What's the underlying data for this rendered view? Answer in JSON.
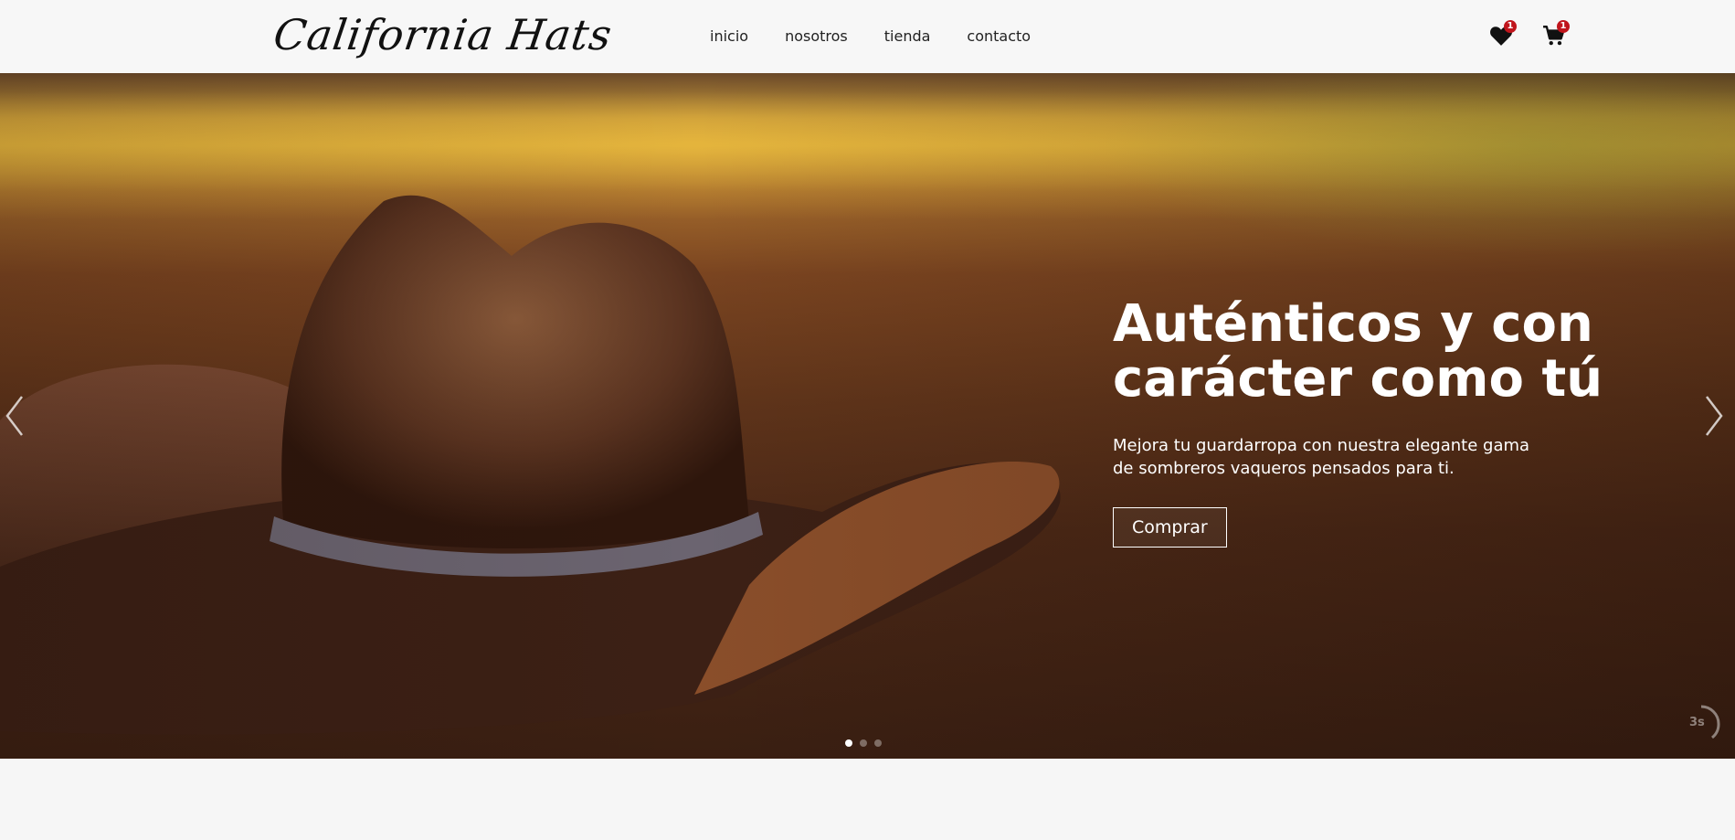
{
  "header": {
    "logo": "California Hats",
    "nav": [
      "inicio",
      "nosotros",
      "tienda",
      "contacto"
    ],
    "wishlist_count": "1",
    "cart_count": "1"
  },
  "hero": {
    "title_line1": "Auténticos y con",
    "title_line2": "carácter como tú",
    "subtitle": "Mejora tu guardarropa con nuestra elegante gama de sombreros vaqueros pensados para ti.",
    "cta_label": "Comprar",
    "autoplay_label": "3s",
    "slide_count": 3,
    "active_slide": 1
  },
  "colors": {
    "badge": "#c0151c",
    "header_bg": "#f7f7f7"
  }
}
